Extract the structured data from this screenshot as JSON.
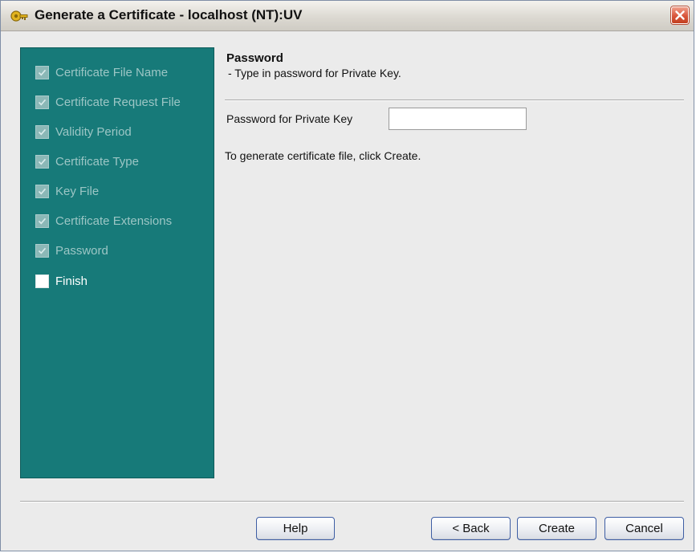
{
  "window": {
    "title": "Generate a Certificate - localhost (NT):UV"
  },
  "sidebar": {
    "steps": [
      {
        "label": "Certificate File Name",
        "checked": true
      },
      {
        "label": "Certificate Request File",
        "checked": true
      },
      {
        "label": "Validity Period",
        "checked": true
      },
      {
        "label": "Certificate Type",
        "checked": true
      },
      {
        "label": "Key File",
        "checked": true
      },
      {
        "label": "Certificate Extensions",
        "checked": true
      },
      {
        "label": "Password",
        "checked": true
      },
      {
        "label": "Finish",
        "checked": false
      }
    ],
    "background_color": "#177a79"
  },
  "content": {
    "title": "Password",
    "subtitle": "- Type in password for Private Key.",
    "password_label": "Password for Private Key",
    "password_value": "",
    "instruction": "To generate certificate file, click Create."
  },
  "buttons": {
    "help": "Help",
    "back": "< Back",
    "create": "Create",
    "cancel": "Cancel"
  },
  "icons": {
    "app": "certificate-app-icon",
    "close": "close-icon",
    "check": "check-icon"
  }
}
